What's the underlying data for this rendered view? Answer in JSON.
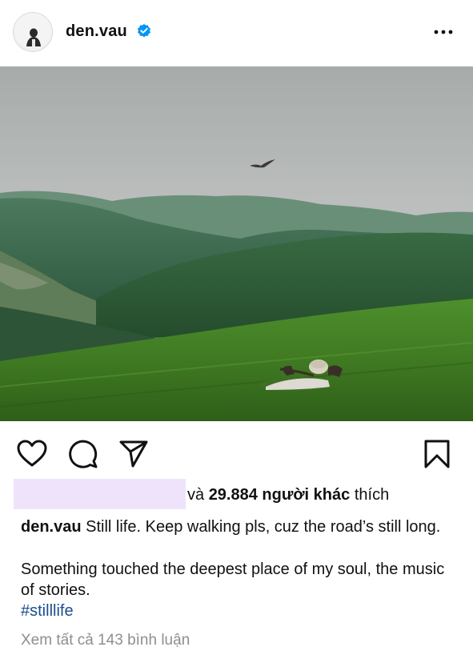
{
  "header": {
    "username": "den.vau",
    "verified_icon": "verified-badge-icon",
    "more_icon": "more-options-icon"
  },
  "photo": {
    "description_icon": "post-photo"
  },
  "actions": {
    "like_icon": "heart-icon",
    "comment_icon": "comment-icon",
    "share_icon": "send-icon",
    "save_icon": "bookmark-icon"
  },
  "likes": {
    "connector": "và",
    "count": "29.884",
    "suffix": "người khác",
    "verb": "thích"
  },
  "caption": {
    "username": "den.vau",
    "line1": "Still life. Keep walking pls, cuz the road’s still long.",
    "line2": "Something touched the deepest place of my soul, the music of stories.",
    "hashtag": "#stilllife"
  },
  "comments": {
    "view_all": "Xem tất cả 143 bình luận"
  },
  "colors": {
    "verified_blue": "#0095f6",
    "hashtag_blue": "#1e4d8c",
    "muted_gray": "#8e8e8e",
    "liker_highlight": "#efe3fb"
  }
}
